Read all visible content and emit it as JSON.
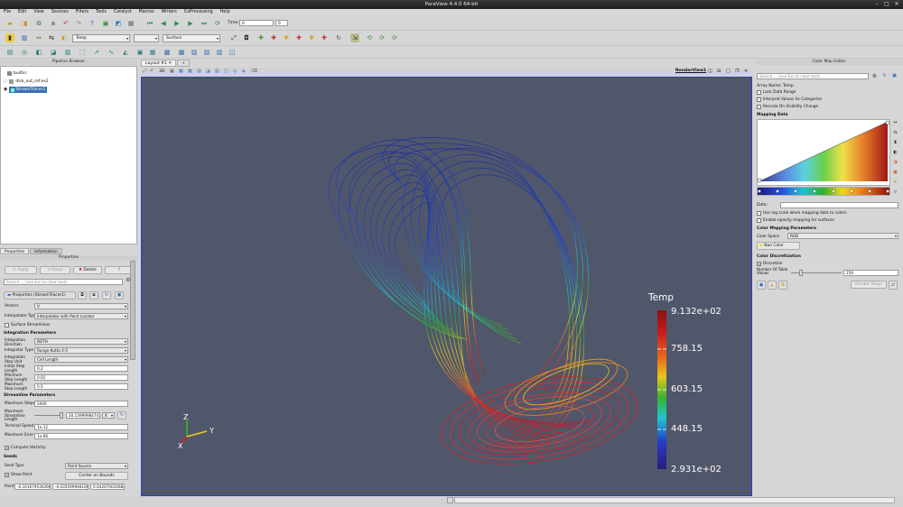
{
  "window": {
    "title": "ParaView 4.4.0 64-bit"
  },
  "menu": [
    "File",
    "Edit",
    "View",
    "Sources",
    "Filters",
    "Tools",
    "Catalyst",
    "Macros",
    "Writers",
    "CoProcessing",
    "Help"
  ],
  "toolbar": {
    "time_label": "Time:",
    "time_value": "0",
    "time_index": "0",
    "color_by": "Temp",
    "representation": "Surface"
  },
  "pipeline_browser": {
    "title": "Pipeline Browser",
    "items": [
      "builtin:",
      "disk_out_ref.ex2",
      "StreamTracer1"
    ]
  },
  "properties_panel": {
    "tabs": [
      "Properties",
      "Information"
    ],
    "title": "Properties",
    "apply": "Apply",
    "reset": "Reset",
    "delete": "Delete",
    "help": "?",
    "search_placeholder": "Search ... (use Esc to clear text)",
    "section_header": "Properties (StreamTracer1)",
    "vectors_label": "Vectors",
    "vectors_value": "V",
    "interpolator_label": "Interpolator Type",
    "interpolator_value": "Interpolator with Point Locator",
    "surface_streamlines": "Surface Streamlines",
    "integration_header": "Integration Parameters",
    "integration_direction_label": "Integration Direction",
    "integration_direction_value": "BOTH",
    "integrator_type_label": "Integrator Type",
    "integrator_type_value": "Runge-Kutta 4-5",
    "step_unit_label": "Integration Step Unit",
    "step_unit_value": "Cell Length",
    "initial_step_label": "Initial Step Length",
    "initial_step_value": "0.2",
    "min_step_label": "Minimum Step Length",
    "min_step_value": "0.01",
    "max_step_label": "Maximum Step Length",
    "max_step_value": "0.5",
    "streamline_header": "Streamline Parameters",
    "max_steps_label": "Maximum Steps",
    "max_steps_value": "2000",
    "max_length_label": "Maximum Streamline Length",
    "max_length_value": "20.15999984741",
    "max_length_unit": "X",
    "terminal_speed_label": "Terminal Speed",
    "terminal_speed_value": "1e-12",
    "max_error_label": "Maximum Error",
    "max_error_value": "1e-06",
    "compute_vorticity": "Compute Vorticity",
    "seeds_header": "Seeds",
    "seed_type_label": "Seed Type",
    "seed_type_value": "Point Source",
    "show_point": "Show Point",
    "center_on_bounds": "Center on Bounds",
    "point_label": "Point",
    "point_x": "-0.16167953026600",
    "point_y": "-0.03559994810640",
    "point_z": "0.04207001068401"
  },
  "view": {
    "tab": "Layout #1",
    "add_tab": "+",
    "label_3d": "3D",
    "render_view_label": "RenderView1",
    "colorbar": {
      "title": "Temp",
      "max": "9.132e+02",
      "t1": "758.15",
      "t2": "603.15",
      "t3": "448.15",
      "min": "2.931e+02"
    },
    "axes": {
      "x": "X",
      "y": "Y",
      "z": "Z"
    }
  },
  "color_map_editor": {
    "title": "Color Map Editor",
    "search_placeholder": "Search ... (use Esc to clear text)",
    "array_name": "Array Name: Temp",
    "lock_data_range": "Lock Data Range",
    "interpret_values": "Interpret Values As Categories",
    "rescale": "Rescale On Visibility Change",
    "mapping_data": "Mapping Data",
    "data_label": "Data:",
    "use_log": "Use log scale when mapping data to colors",
    "enable_opacity": "Enable opacity mapping for surfaces",
    "color_mapping_params": "Color Mapping Parameters",
    "color_space_label": "Color Space",
    "color_space_value": "RGB",
    "nan_color": "Nan Color",
    "color_discretization": "Color Discretization",
    "discretize": "Discretize",
    "num_table_values_label": "Number Of Table Values",
    "num_table_values": "256",
    "render_views": "Render Views"
  }
}
